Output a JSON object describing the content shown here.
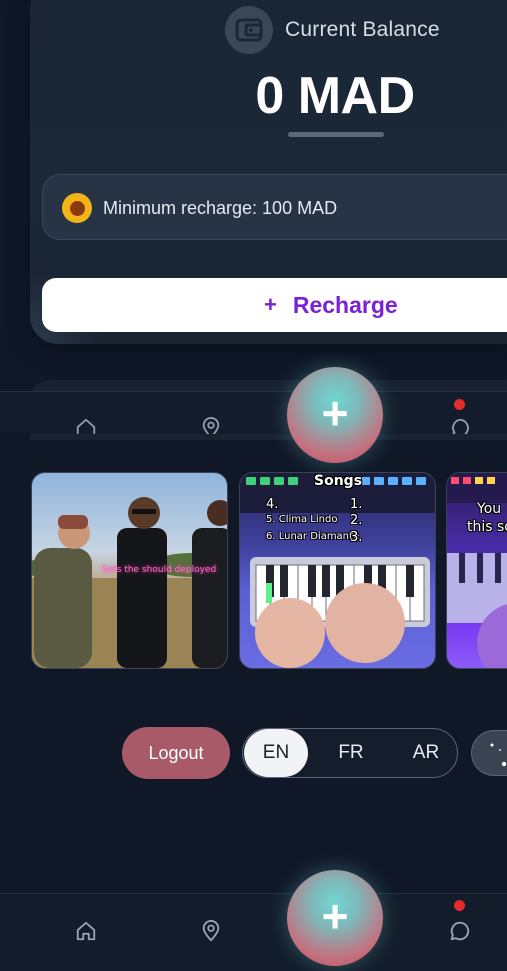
{
  "balance": {
    "label": "Current Balance",
    "amount": "0 MAD",
    "min_recharge": "Minimum recharge: 100 MAD",
    "recharge_plus": "+",
    "recharge_label": "Recharge"
  },
  "thumbnails": [
    {
      "overlay": "Sets the should deployed"
    },
    {
      "title": "Songs",
      "lines": [
        "4.",
        "1.",
        "5. Clima Lindo",
        "2.",
        "6. Lunar Diamante",
        "3."
      ]
    },
    {
      "lines": [
        "You",
        "this so"
      ]
    }
  ],
  "actions": {
    "logout": "Logout",
    "languages": [
      "EN",
      "FR",
      "AR"
    ],
    "active_language": "EN"
  },
  "nav": {
    "fab_label": "+",
    "items": [
      "home-icon",
      "location-icon",
      "add-button",
      "chat-icon"
    ],
    "chat_has_notification": true
  },
  "colors": {
    "accent_purple": "#7a22d6",
    "logout_bg": "#a85a68",
    "coin": "#f2b419",
    "notification": "#e32b2b"
  }
}
